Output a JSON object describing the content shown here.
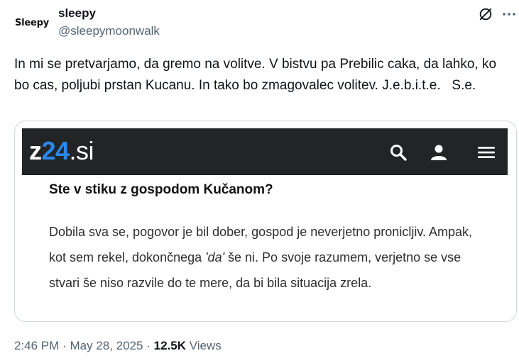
{
  "author": {
    "avatar_text": "Sleepy",
    "display_name": "sleepy",
    "handle": "@sleepymoonwalk"
  },
  "icons": {
    "grok": "grok-slash-circle-icon",
    "more": "more-horizontal-icon",
    "search": "search-icon",
    "user": "user-icon",
    "menu": "hamburger-menu-icon"
  },
  "tweet": {
    "text": "In mi se pretvarjamo, da gremo na volitve. V bistvu pa Prebilic caka, da lahko, ko bo cas, poljubi prstan Kucanu. In tako bo zmagovalec volitev. J.e.b.i.t.e.   S.e."
  },
  "media": {
    "site_logo": {
      "z": "z",
      "num": "24",
      "tld": ".si"
    },
    "heading": "Ste v stiku z gospodom Kučanom?",
    "body_before": "Dobila sva se, pogovor je bil dober, gospod je neverjetno pronicljiv. Ampak, kot sem rekel, dokončnega ",
    "body_emphasis": "'da'",
    "body_after": " še ni. Po svoje razumem, verjetno se vse stvari še niso razvile do te mere, da bi bila situacija zrela."
  },
  "meta": {
    "time": "2:46 PM",
    "separator": "·",
    "date": "May 28, 2025",
    "views_count": "12.5K",
    "views_label": "Views"
  },
  "colors": {
    "accent_blue": "#2b88e6",
    "site_header_bg": "#222426",
    "secondary_text": "#536471"
  }
}
